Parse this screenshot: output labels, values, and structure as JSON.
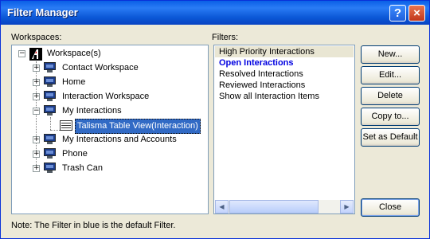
{
  "window": {
    "title": "Filter Manager",
    "help_glyph": "?",
    "close_glyph": "×"
  },
  "workspaces": {
    "label": "Workspaces:",
    "root": "Workspace(s)",
    "items": [
      "Contact Workspace",
      "Home",
      "Interaction Workspace",
      "My Interactions",
      "Talisma Table View(Interaction)",
      "My Interactions and Accounts",
      "Phone",
      "Trash Can"
    ]
  },
  "filters": {
    "label": "Filters:",
    "items": [
      "High Priority Interactions",
      "Open Interactions",
      "Resolved Interactions",
      "Reviewed Interactions",
      "Show all Interaction Items"
    ],
    "selected_index": 0,
    "default_index": 1
  },
  "buttons": {
    "new": "New...",
    "edit": "Edit...",
    "delete": "Delete",
    "copy": "Copy to...",
    "set_default": "Set as Default",
    "close": "Close"
  },
  "note": "Note: The Filter in blue is the default Filter.",
  "colors": {
    "titlebar": "#0a5fe6",
    "default_filter": "#0000e0",
    "selection": "#316ac5"
  }
}
